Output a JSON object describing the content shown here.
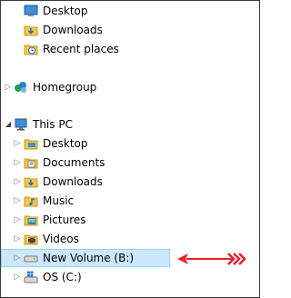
{
  "nav": {
    "quick_access": [
      {
        "label": "Desktop",
        "icon": "desktop-folder-icon"
      },
      {
        "label": "Downloads",
        "icon": "downloads-folder-icon"
      },
      {
        "label": "Recent places",
        "icon": "recent-places-icon"
      }
    ],
    "homegroup": {
      "label": "Homegroup",
      "icon": "homegroup-icon"
    },
    "this_pc": {
      "label": "This PC",
      "icon": "computer-icon",
      "children": [
        {
          "label": "Desktop",
          "icon": "desktop-folder-icon"
        },
        {
          "label": "Documents",
          "icon": "documents-folder-icon"
        },
        {
          "label": "Downloads",
          "icon": "downloads-folder-icon"
        },
        {
          "label": "Music",
          "icon": "music-folder-icon"
        },
        {
          "label": "Pictures",
          "icon": "pictures-folder-icon"
        },
        {
          "label": "Videos",
          "icon": "videos-folder-icon"
        },
        {
          "label": "New Volume (B:)",
          "icon": "drive-icon",
          "selected": true
        },
        {
          "label": "OS (C:)",
          "icon": "os-drive-icon"
        }
      ]
    }
  },
  "colors": {
    "selection_bg": "#cce8ff",
    "selection_border": "#99d1ff",
    "arrow": "#e8202a",
    "folder": "#f3c64a"
  }
}
